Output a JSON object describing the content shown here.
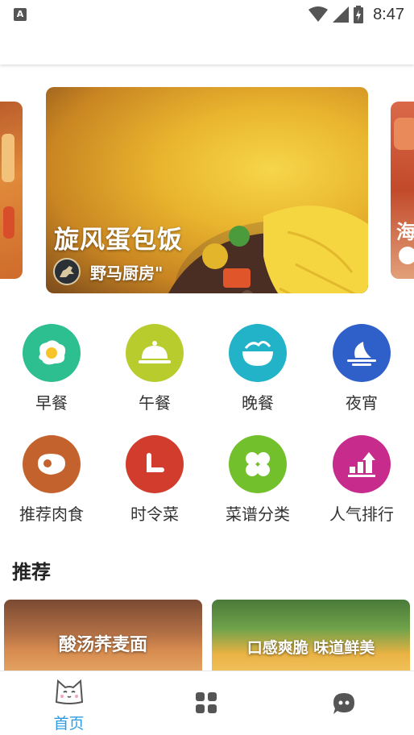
{
  "status_bar": {
    "notification_icon": "A",
    "time": "8:47",
    "icons": [
      "wifi-icon",
      "cell-signal-icon",
      "battery-charging-icon"
    ]
  },
  "banner": {
    "title": "旋风蛋包饭",
    "author": "野马厨房\"",
    "right_peek_text": "海"
  },
  "categories": [
    {
      "label": "早餐",
      "icon": "fried-egg-icon",
      "color": "#2dbf8f"
    },
    {
      "label": "午餐",
      "icon": "cloche-icon",
      "color": "#b8cc2e"
    },
    {
      "label": "晚餐",
      "icon": "bowl-icon",
      "color": "#22b3c9"
    },
    {
      "label": "夜宵",
      "icon": "moon-icon",
      "color": "#2f60c9"
    },
    {
      "label": "推荐肉食",
      "icon": "steak-icon",
      "color": "#c4622e"
    },
    {
      "label": "时令菜",
      "icon": "clock-icon",
      "color": "#d23c2c"
    },
    {
      "label": "菜谱分类",
      "icon": "clover-icon",
      "color": "#72c02b"
    },
    {
      "label": "人气排行",
      "icon": "ranking-icon",
      "color": "#c72b8c"
    }
  ],
  "recommend": {
    "title": "推荐",
    "cards": [
      {
        "text": "酸汤荞麦面"
      },
      {
        "text": "口感爽脆 味道鲜美"
      }
    ]
  },
  "bottom_nav": {
    "home_label": "首页",
    "accent": "#2f9be0",
    "icons": [
      "cat-face-icon",
      "grid-icon",
      "chat-bubble-icon"
    ]
  }
}
